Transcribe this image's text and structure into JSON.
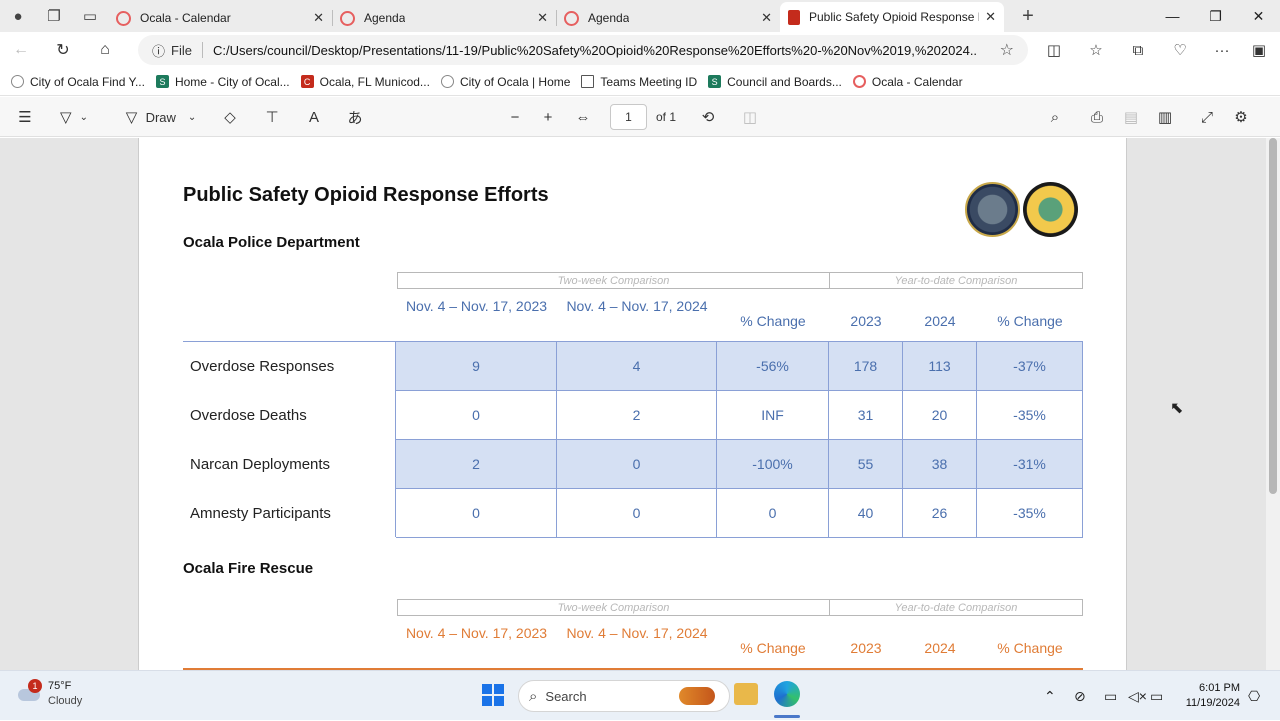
{
  "tabs": [
    {
      "label": "Ocala - Calendar",
      "favicon": "g-icon",
      "color": "#e65f5f"
    },
    {
      "label": "Agenda",
      "favicon": "g-icon",
      "color": "#e65f5f"
    },
    {
      "label": "Agenda",
      "favicon": "g-icon",
      "color": "#e65f5f"
    },
    {
      "label": "Public Safety Opioid Response Eff",
      "favicon": "pdf-icon",
      "color": "#c42b1c",
      "active": true
    }
  ],
  "address": {
    "scheme_label": "File",
    "url": "C:/Users/council/Desktop/Presentations/11-19/Public%20Safety%20Opioid%20Response%20Efforts%20-%20Nov%2019,%202024...."
  },
  "bookmarks": [
    {
      "label": "City of Ocala Find Y...",
      "icon": "circle-icon"
    },
    {
      "label": "Home - City of Ocal...",
      "icon": "s-icon"
    },
    {
      "label": "Ocala, FL Municod...",
      "icon": "municode-icon"
    },
    {
      "label": "City of Ocala | Home",
      "icon": "circle-icon"
    },
    {
      "label": "Teams Meeting ID",
      "icon": "doc-icon"
    },
    {
      "label": "Council and Boards...",
      "icon": "s-icon"
    },
    {
      "label": "Ocala - Calendar",
      "icon": "g-icon"
    }
  ],
  "pdf_toolbar": {
    "draw_label": "Draw",
    "page_number": "1",
    "page_total": "of 1"
  },
  "document": {
    "title": "Public Safety Opioid Response Efforts",
    "police": {
      "heading": "Ocala Police Department",
      "two_week_label": "Two-week Comparison",
      "ytd_label": "Year-to-date Comparison",
      "columns": [
        "Nov. 4 – Nov. 17, 2023",
        "Nov. 4 – Nov. 17, 2024",
        "% Change",
        "2023",
        "2024",
        "% Change"
      ],
      "rows": [
        {
          "label": "Overdose Responses",
          "values": [
            "9",
            "4",
            "-56%",
            "178",
            "113",
            "-37%"
          ]
        },
        {
          "label": "Overdose Deaths",
          "values": [
            "0",
            "2",
            "INF",
            "31",
            "20",
            "-35%"
          ]
        },
        {
          "label": "Narcan Deployments",
          "values": [
            "2",
            "0",
            "-100%",
            "55",
            "38",
            "-31%"
          ]
        },
        {
          "label": "Amnesty Participants",
          "values": [
            "0",
            "0",
            "0",
            "40",
            "26",
            "-35%"
          ]
        }
      ]
    },
    "fire": {
      "heading": "Ocala Fire Rescue",
      "two_week_label": "Two-week Comparison",
      "ytd_label": "Year-to-date Comparison",
      "columns": [
        "Nov. 4 – Nov. 17, 2023",
        "Nov. 4 – Nov. 17, 2024",
        "% Change",
        "2023",
        "2024",
        "% Change"
      ]
    }
  },
  "taskbar": {
    "temp": "75°F",
    "condition": "Cloudy",
    "badge": "1",
    "search_placeholder": "Search",
    "time": "6:01 PM",
    "date": "11/19/2024"
  },
  "colors": {
    "police_accent": "#4a6fad",
    "fire_accent": "#e07c36",
    "row_highlight": "#d5e0f3"
  }
}
